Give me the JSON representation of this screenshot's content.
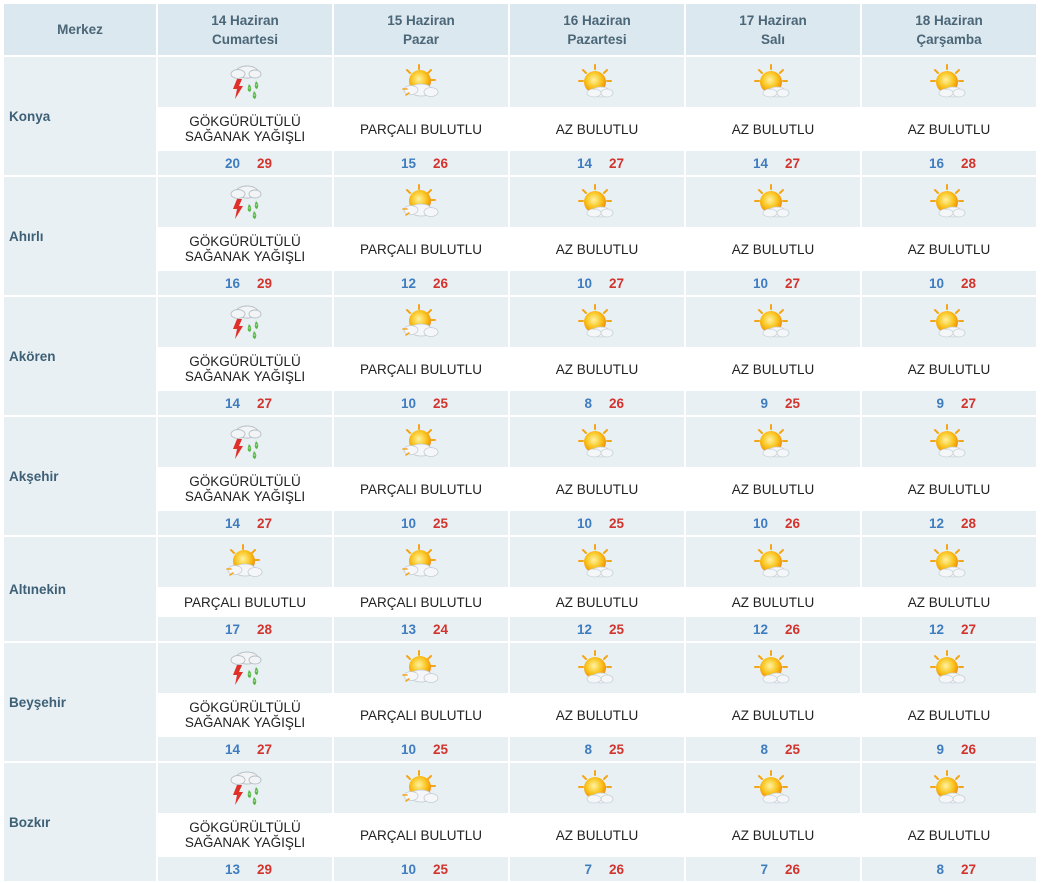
{
  "header": {
    "center_label": "Merkez",
    "days": [
      {
        "date": "14 Haziran",
        "weekday": "Cumartesi"
      },
      {
        "date": "15 Haziran",
        "weekday": "Pazar"
      },
      {
        "date": "16 Haziran",
        "weekday": "Pazartesi"
      },
      {
        "date": "17 Haziran",
        "weekday": "Salı"
      },
      {
        "date": "18 Haziran",
        "weekday": "Çarşamba"
      }
    ]
  },
  "colors": {
    "min_temp": "#3e7cc0",
    "max_temp": "#d2332d",
    "header_bg": "#dce8ef",
    "row_bg": "#e9f0f4"
  },
  "cities": [
    {
      "name": "Konya",
      "forecast": [
        {
          "icon": "thunderstorm-rain-icon",
          "desc_line1": "GÖKGÜRÜLTÜLÜ",
          "desc_line2": "SAĞANAK YAĞIŞLI",
          "min": "20",
          "max": "29"
        },
        {
          "icon": "partly-cloudy-icon",
          "desc_line1": "PARÇALI BULUTLU",
          "desc_line2": "",
          "min": "15",
          "max": "26"
        },
        {
          "icon": "mostly-sunny-icon",
          "desc_line1": "AZ BULUTLU",
          "desc_line2": "",
          "min": "14",
          "max": "27"
        },
        {
          "icon": "mostly-sunny-icon",
          "desc_line1": "AZ BULUTLU",
          "desc_line2": "",
          "min": "14",
          "max": "27"
        },
        {
          "icon": "mostly-sunny-icon",
          "desc_line1": "AZ BULUTLU",
          "desc_line2": "",
          "min": "16",
          "max": "28"
        }
      ]
    },
    {
      "name": "Ahırlı",
      "forecast": [
        {
          "icon": "thunderstorm-rain-icon",
          "desc_line1": "GÖKGÜRÜLTÜLÜ",
          "desc_line2": "SAĞANAK YAĞIŞLI",
          "min": "16",
          "max": "29"
        },
        {
          "icon": "partly-cloudy-icon",
          "desc_line1": "PARÇALI BULUTLU",
          "desc_line2": "",
          "min": "12",
          "max": "26"
        },
        {
          "icon": "mostly-sunny-icon",
          "desc_line1": "AZ BULUTLU",
          "desc_line2": "",
          "min": "10",
          "max": "27"
        },
        {
          "icon": "mostly-sunny-icon",
          "desc_line1": "AZ BULUTLU",
          "desc_line2": "",
          "min": "10",
          "max": "27"
        },
        {
          "icon": "mostly-sunny-icon",
          "desc_line1": "AZ BULUTLU",
          "desc_line2": "",
          "min": "10",
          "max": "28"
        }
      ]
    },
    {
      "name": "Akören",
      "forecast": [
        {
          "icon": "thunderstorm-rain-icon",
          "desc_line1": "GÖKGÜRÜLTÜLÜ",
          "desc_line2": "SAĞANAK YAĞIŞLI",
          "min": "14",
          "max": "27"
        },
        {
          "icon": "partly-cloudy-icon",
          "desc_line1": "PARÇALI BULUTLU",
          "desc_line2": "",
          "min": "10",
          "max": "25"
        },
        {
          "icon": "mostly-sunny-icon",
          "desc_line1": "AZ BULUTLU",
          "desc_line2": "",
          "min": "8",
          "max": "26"
        },
        {
          "icon": "mostly-sunny-icon",
          "desc_line1": "AZ BULUTLU",
          "desc_line2": "",
          "min": "9",
          "max": "25"
        },
        {
          "icon": "mostly-sunny-icon",
          "desc_line1": "AZ BULUTLU",
          "desc_line2": "",
          "min": "9",
          "max": "27"
        }
      ]
    },
    {
      "name": "Akşehir",
      "forecast": [
        {
          "icon": "thunderstorm-rain-icon",
          "desc_line1": "GÖKGÜRÜLTÜLÜ",
          "desc_line2": "SAĞANAK YAĞIŞLI",
          "min": "14",
          "max": "27"
        },
        {
          "icon": "partly-cloudy-icon",
          "desc_line1": "PARÇALI BULUTLU",
          "desc_line2": "",
          "min": "10",
          "max": "25"
        },
        {
          "icon": "mostly-sunny-icon",
          "desc_line1": "AZ BULUTLU",
          "desc_line2": "",
          "min": "10",
          "max": "25"
        },
        {
          "icon": "mostly-sunny-icon",
          "desc_line1": "AZ BULUTLU",
          "desc_line2": "",
          "min": "10",
          "max": "26"
        },
        {
          "icon": "mostly-sunny-icon",
          "desc_line1": "AZ BULUTLU",
          "desc_line2": "",
          "min": "12",
          "max": "28"
        }
      ]
    },
    {
      "name": "Altınekin",
      "forecast": [
        {
          "icon": "partly-cloudy-icon",
          "desc_line1": "PARÇALI BULUTLU",
          "desc_line2": "",
          "min": "17",
          "max": "28"
        },
        {
          "icon": "partly-cloudy-icon",
          "desc_line1": "PARÇALI BULUTLU",
          "desc_line2": "",
          "min": "13",
          "max": "24"
        },
        {
          "icon": "mostly-sunny-icon",
          "desc_line1": "AZ BULUTLU",
          "desc_line2": "",
          "min": "12",
          "max": "25"
        },
        {
          "icon": "mostly-sunny-icon",
          "desc_line1": "AZ BULUTLU",
          "desc_line2": "",
          "min": "12",
          "max": "26"
        },
        {
          "icon": "mostly-sunny-icon",
          "desc_line1": "AZ BULUTLU",
          "desc_line2": "",
          "min": "12",
          "max": "27"
        }
      ]
    },
    {
      "name": "Beyşehir",
      "forecast": [
        {
          "icon": "thunderstorm-rain-icon",
          "desc_line1": "GÖKGÜRÜLTÜLÜ",
          "desc_line2": "SAĞANAK YAĞIŞLI",
          "min": "14",
          "max": "27"
        },
        {
          "icon": "partly-cloudy-icon",
          "desc_line1": "PARÇALI BULUTLU",
          "desc_line2": "",
          "min": "10",
          "max": "25"
        },
        {
          "icon": "mostly-sunny-icon",
          "desc_line1": "AZ BULUTLU",
          "desc_line2": "",
          "min": "8",
          "max": "25"
        },
        {
          "icon": "mostly-sunny-icon",
          "desc_line1": "AZ BULUTLU",
          "desc_line2": "",
          "min": "8",
          "max": "25"
        },
        {
          "icon": "mostly-sunny-icon",
          "desc_line1": "AZ BULUTLU",
          "desc_line2": "",
          "min": "9",
          "max": "26"
        }
      ]
    },
    {
      "name": "Bozkır",
      "forecast": [
        {
          "icon": "thunderstorm-rain-icon",
          "desc_line1": "GÖKGÜRÜLTÜLÜ",
          "desc_line2": "SAĞANAK YAĞIŞLI",
          "min": "13",
          "max": "29"
        },
        {
          "icon": "partly-cloudy-icon",
          "desc_line1": "PARÇALI BULUTLU",
          "desc_line2": "",
          "min": "10",
          "max": "25"
        },
        {
          "icon": "mostly-sunny-icon",
          "desc_line1": "AZ BULUTLU",
          "desc_line2": "",
          "min": "7",
          "max": "26"
        },
        {
          "icon": "mostly-sunny-icon",
          "desc_line1": "AZ BULUTLU",
          "desc_line2": "",
          "min": "7",
          "max": "26"
        },
        {
          "icon": "mostly-sunny-icon",
          "desc_line1": "AZ BULUTLU",
          "desc_line2": "",
          "min": "8",
          "max": "27"
        }
      ]
    }
  ]
}
